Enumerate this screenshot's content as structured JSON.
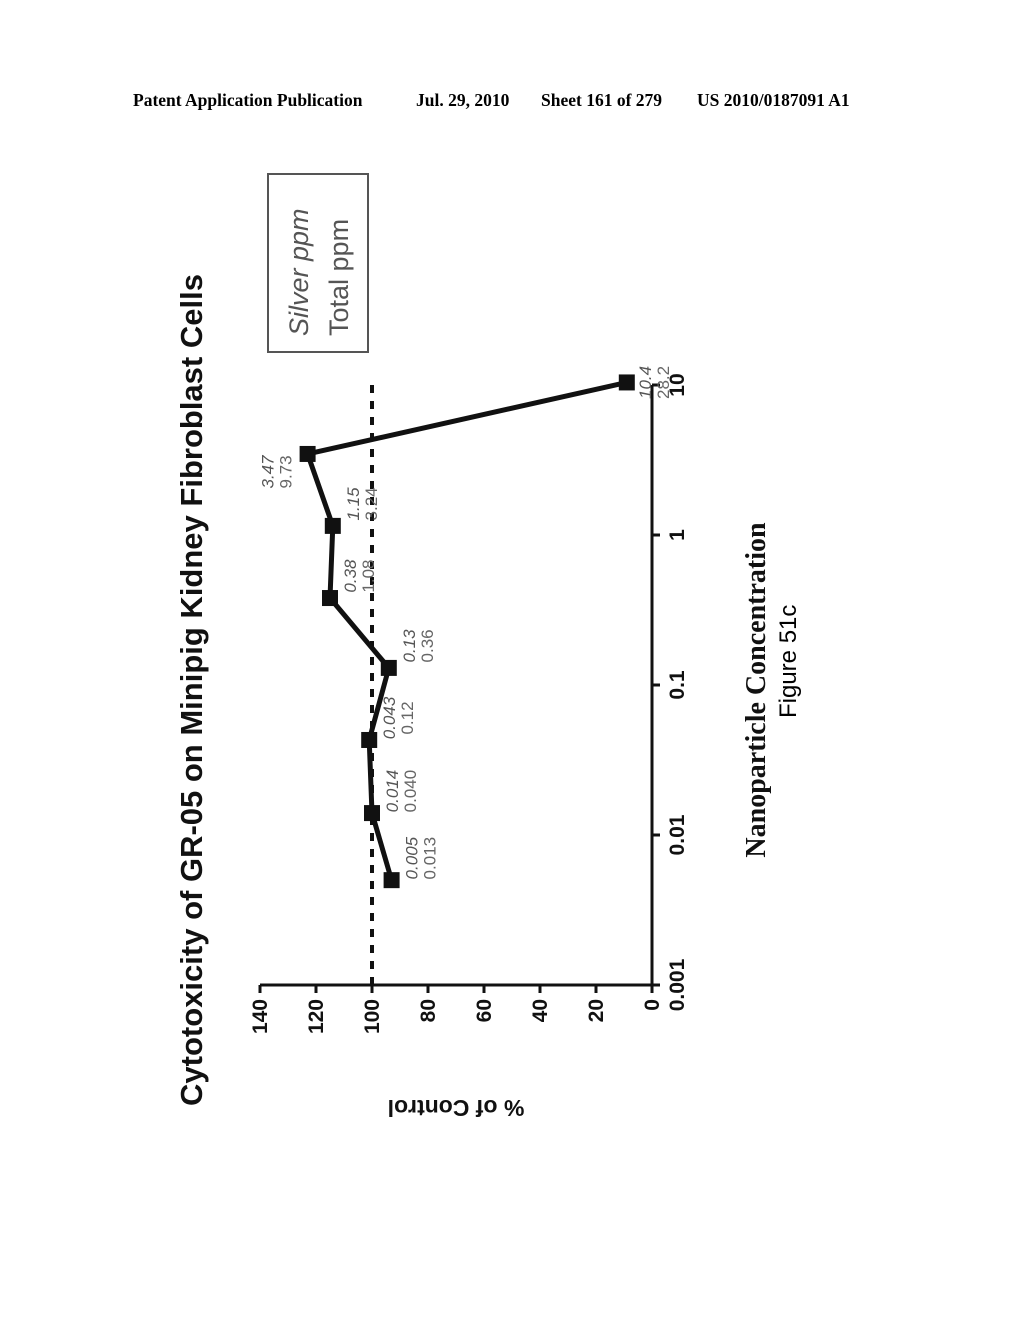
{
  "header": {
    "publication": "Patent Application Publication",
    "date": "Jul. 29, 2010",
    "sheet": "Sheet 161 of 279",
    "number": "US 2010/0187091 A1"
  },
  "caption": "Figure 51c",
  "chart_data": {
    "type": "line",
    "orientation": "rotated 90° counterclockwise on page",
    "title": "Cytotoxicity of GR-05 on Minipig Kidney Fibroblast Cells",
    "xlabel": "Nanoparticle Concentration",
    "ylabel": "% of Control",
    "xscale": "log",
    "xlim": [
      0.001,
      10
    ],
    "ylim": [
      0,
      140
    ],
    "xticks": [
      "0.001",
      "0.01",
      "0.1",
      "1",
      "10"
    ],
    "yticks": [
      "0",
      "20",
      "40",
      "60",
      "80",
      "100",
      "120",
      "140"
    ],
    "reference_line": {
      "y": 100,
      "style": "dashed"
    },
    "legend": {
      "placement": "top-right",
      "entries": [
        "Silver ppm",
        "Total ppm"
      ]
    },
    "series": [
      {
        "name": "GR-05",
        "x": [
          0.005,
          0.014,
          0.043,
          0.13,
          0.38,
          1.15,
          3.47,
          10.4
        ],
        "y": [
          93,
          100,
          101,
          94,
          115,
          114,
          123,
          9
        ],
        "marker": "square"
      }
    ],
    "annotations": [
      {
        "silver_ppm": "0.005",
        "total_ppm": "0.013"
      },
      {
        "silver_ppm": "0.014",
        "total_ppm": "0.040"
      },
      {
        "silver_ppm": "0.043",
        "total_ppm": "0.12"
      },
      {
        "silver_ppm": "0.13",
        "total_ppm": "0.36"
      },
      {
        "silver_ppm": "0.38",
        "total_ppm": "1.08"
      },
      {
        "silver_ppm": "1.15",
        "total_ppm": "3.24"
      },
      {
        "silver_ppm": "3.47",
        "total_ppm": "9.73"
      },
      {
        "silver_ppm": "10.4",
        "total_ppm": "28.2"
      }
    ]
  }
}
